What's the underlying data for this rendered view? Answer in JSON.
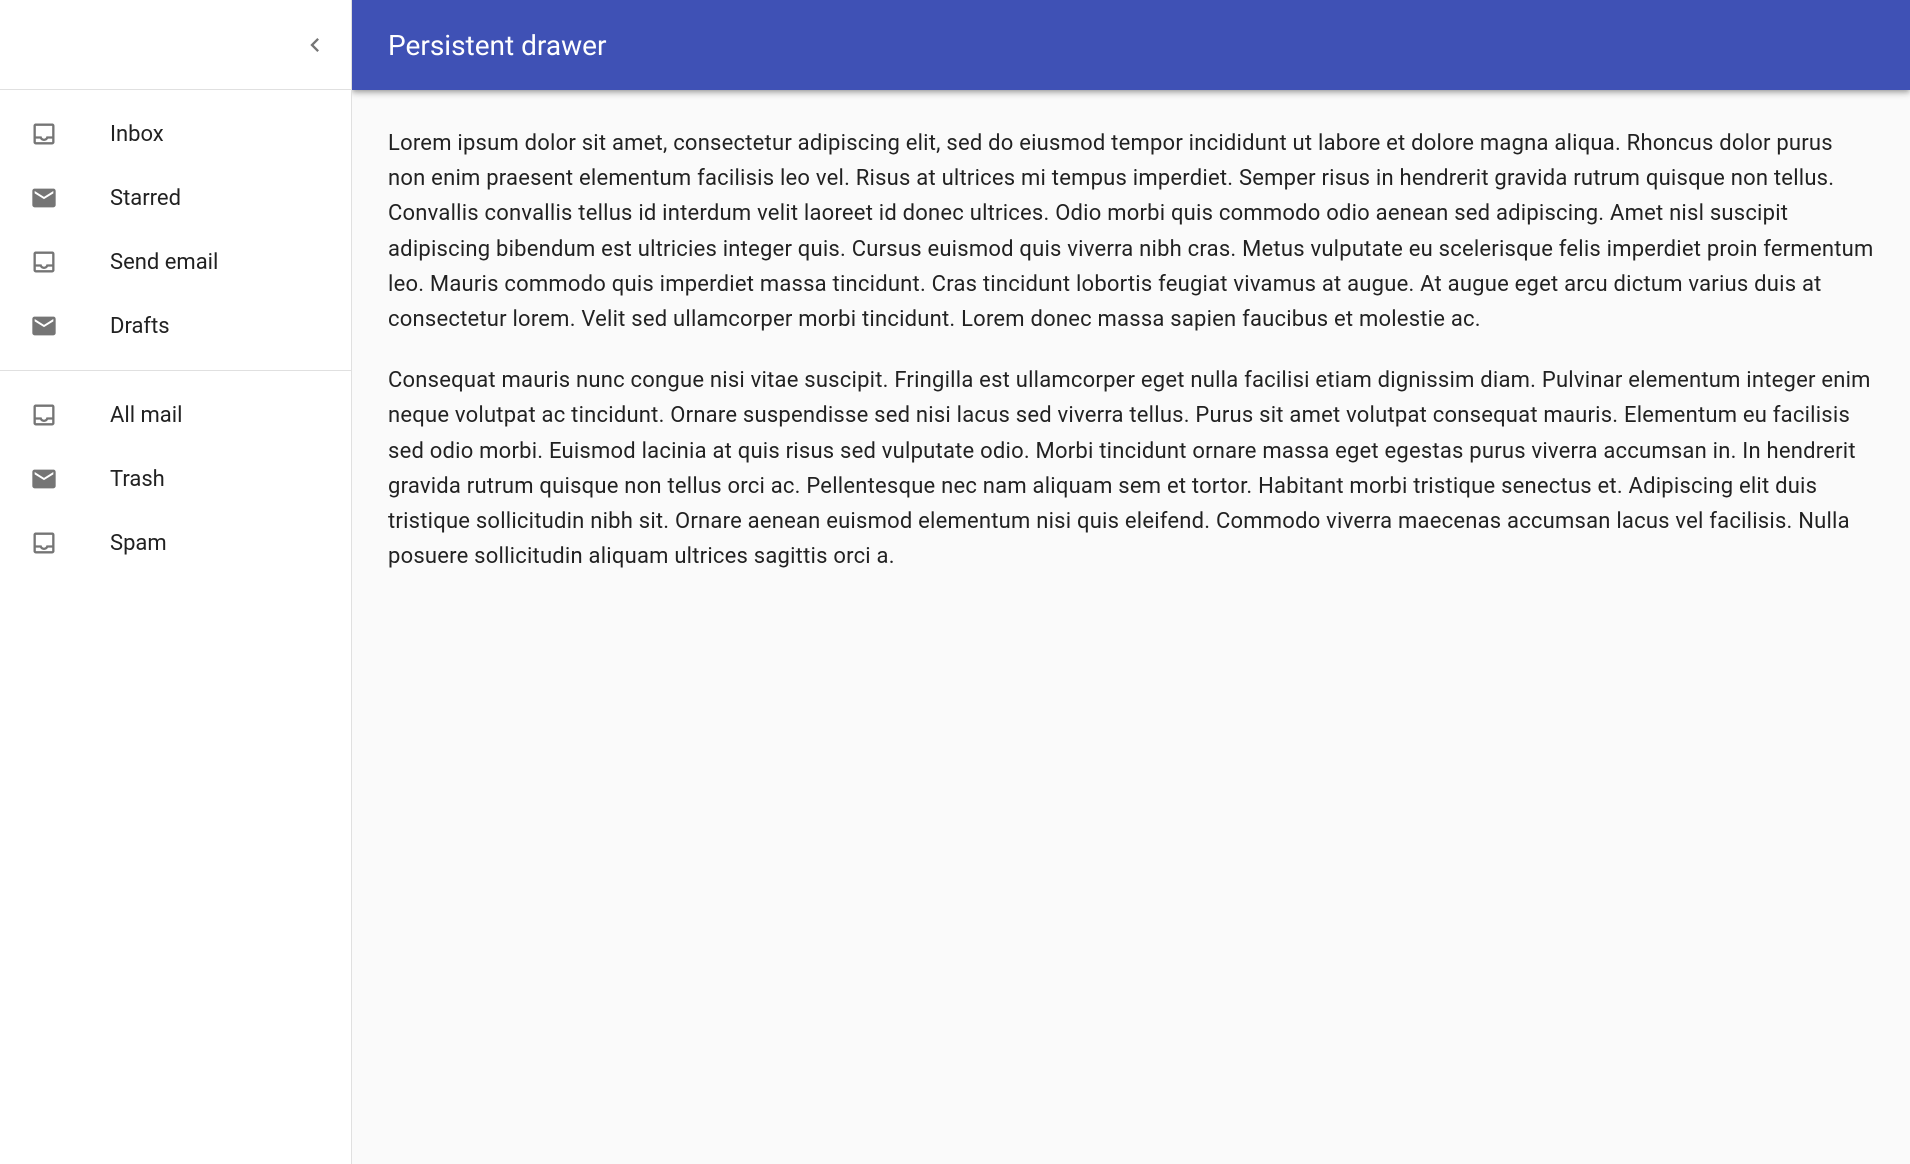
{
  "header": {
    "title": "Persistent drawer"
  },
  "drawer": {
    "primary": [
      {
        "label": "Inbox",
        "icon": "inbox"
      },
      {
        "label": "Starred",
        "icon": "mail"
      },
      {
        "label": "Send email",
        "icon": "inbox"
      },
      {
        "label": "Drafts",
        "icon": "mail"
      }
    ],
    "secondary": [
      {
        "label": "All mail",
        "icon": "inbox"
      },
      {
        "label": "Trash",
        "icon": "mail"
      },
      {
        "label": "Spam",
        "icon": "inbox"
      }
    ]
  },
  "content": {
    "p1": "Lorem ipsum dolor sit amet, consectetur adipiscing elit, sed do eiusmod tempor incididunt ut labore et dolore magna aliqua. Rhoncus dolor purus non enim praesent elementum facilisis leo vel. Risus at ultrices mi tempus imperdiet. Semper risus in hendrerit gravida rutrum quisque non tellus. Convallis convallis tellus id interdum velit laoreet id donec ultrices. Odio morbi quis commodo odio aenean sed adipiscing. Amet nisl suscipit adipiscing bibendum est ultricies integer quis. Cursus euismod quis viverra nibh cras. Metus vulputate eu scelerisque felis imperdiet proin fermentum leo. Mauris commodo quis imperdiet massa tincidunt. Cras tincidunt lobortis feugiat vivamus at augue. At augue eget arcu dictum varius duis at consectetur lorem. Velit sed ullamcorper morbi tincidunt. Lorem donec massa sapien faucibus et molestie ac.",
    "p2": "Consequat mauris nunc congue nisi vitae suscipit. Fringilla est ullamcorper eget nulla facilisi etiam dignissim diam. Pulvinar elementum integer enim neque volutpat ac tincidunt. Ornare suspendisse sed nisi lacus sed viverra tellus. Purus sit amet volutpat consequat mauris. Elementum eu facilisis sed odio morbi. Euismod lacinia at quis risus sed vulputate odio. Morbi tincidunt ornare massa eget egestas purus viverra accumsan in. In hendrerit gravida rutrum quisque non tellus orci ac. Pellentesque nec nam aliquam sem et tortor. Habitant morbi tristique senectus et. Adipiscing elit duis tristique sollicitudin nibh sit. Ornare aenean euismod elementum nisi quis eleifend. Commodo viverra maecenas accumsan lacus vel facilisis. Nulla posuere sollicitudin aliquam ultrices sagittis orci a."
  }
}
